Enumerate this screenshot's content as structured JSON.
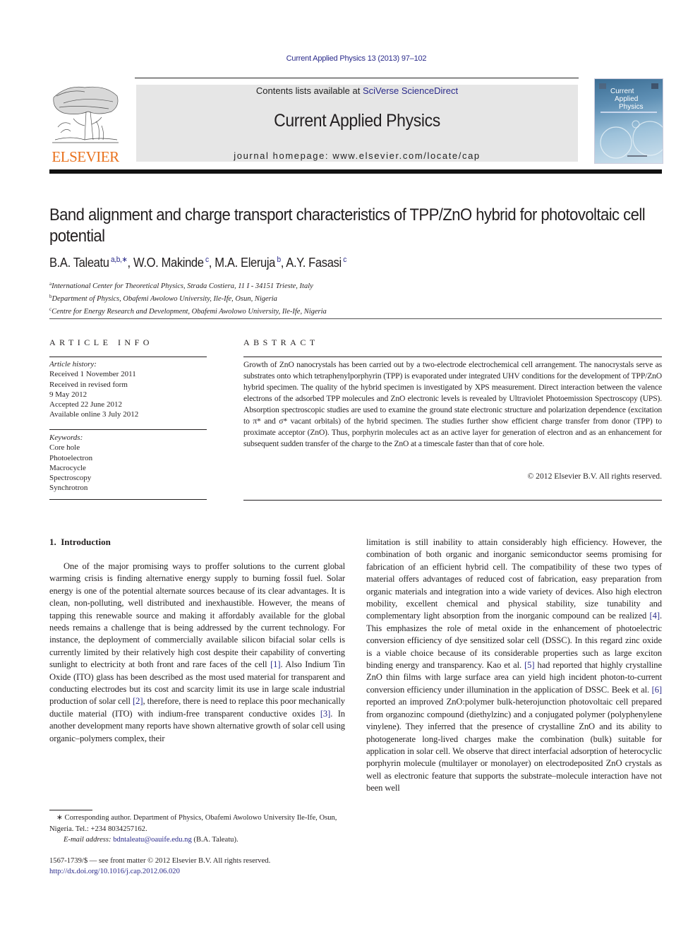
{
  "header": {
    "journal_ref": "Current Applied Physics 13 (2013) 97–102",
    "contents_prefix": "Contents lists available at ",
    "contents_link": "SciVerse ScienceDirect",
    "journal_name": "Current Applied Physics",
    "homepage": "journal homepage: www.elsevier.com/locate/cap",
    "publisher_logo_text": "ELSEVIER",
    "cover": {
      "line1": "Current",
      "line2": "Applied",
      "line3": "Physics"
    }
  },
  "article": {
    "title": "Band alignment and charge transport characteristics of TPP/ZnO hybrid for photovoltaic cell potential",
    "authors": [
      {
        "name": "B.A. Taleatu",
        "sup": "a,b,∗"
      },
      {
        "name": "W.O. Makinde",
        "sup": "c"
      },
      {
        "name": "M.A. Eleruja",
        "sup": "b"
      },
      {
        "name": "A.Y. Fasasi",
        "sup": "c"
      }
    ],
    "affiliations": [
      {
        "mark": "a",
        "text": "International Center for Theoretical Physics, Strada Costiera, 11 I - 34151 Trieste, Italy"
      },
      {
        "mark": "b",
        "text": "Department of Physics, Obafemi Awolowo University, Ile-Ife, Osun, Nigeria"
      },
      {
        "mark": "c",
        "text": "Centre for Energy Research and Development, Obafemi Awolowo University, Ile-Ife, Nigeria"
      }
    ]
  },
  "article_info": {
    "heading": "ARTICLE INFO",
    "history_label": "Article history:",
    "history": [
      "Received 1 November 2011",
      "Received in revised form",
      "9 May 2012",
      "Accepted 22 June 2012",
      "Available online 3 July 2012"
    ],
    "keywords_label": "Keywords:",
    "keywords": [
      "Core hole",
      "Photoelectron",
      "Macrocycle",
      "Spectroscopy",
      "Synchrotron"
    ]
  },
  "abstract": {
    "heading": "ABSTRACT",
    "text": "Growth of ZnO nanocrystals has been carried out by a two-electrode electrochemical cell arrangement. The nanocrystals serve as substrates onto which tetraphenylporphyrin (TPP) is evaporated under integrated UHV conditions for the development of TPP/ZnO hybrid specimen. The quality of the hybrid specimen is investigated by XPS measurement. Direct interaction between the valence electrons of the adsorbed TPP molecules and ZnO electronic levels is revealed by Ultraviolet Photoemission Spectroscopy (UPS). Absorption spectroscopic studies are used to examine the ground state electronic structure and polarization dependence (excitation to π* and σ* vacant orbitals) of the hybrid specimen. The studies further show efficient charge transfer from donor (TPP) to proximate acceptor (ZnO). Thus, porphyrin molecules act as an active layer for generation of electron and as an enhancement for subsequent sudden transfer of the charge to the ZnO at a timescale faster than that of core hole.",
    "copyright": "© 2012 Elsevier B.V. All rights reserved."
  },
  "body": {
    "section_heading": "1.  Introduction",
    "left_column": [
      {
        "t": "One of the major promising ways to proffer solutions to the current global warming crisis is finding alternative energy supply to burning fossil fuel. Solar energy is one of the potential alternate sources because of its clear advantages. It is clean, non-polluting, well distributed and inexhaustible. However, the means of tapping this renewable source and making it affordably available for the global needs remains a challenge that is being addressed by the current technology. For instance, the deployment of commercially available silicon bifacial solar cells is currently limited by their relatively high cost despite their capability of converting sunlight to electricity at both front and rare faces of the cell "
      },
      {
        "ref": "[1]"
      },
      {
        "t": ". Also Indium Tin Oxide (ITO) glass has been described as the most used material for transparent and conducting electrodes but its cost and scarcity limit its use in large scale industrial production of solar cell "
      },
      {
        "ref": "[2]"
      },
      {
        "t": ", therefore, there is need to replace this poor mechanically ductile material (ITO) with indium-free transparent conductive oxides "
      },
      {
        "ref": "[3]"
      },
      {
        "t": ". In another development many reports have shown alternative growth of solar cell using organic–polymers complex, their"
      }
    ],
    "right_column": [
      {
        "t": "limitation is still inability to attain considerably high efficiency. However, the combination of both organic and inorganic semiconductor seems promising for fabrication of an efficient hybrid cell. The compatibility of these two types of material offers advantages of reduced cost of fabrication, easy preparation from organic materials and integration into a wide variety of devices. Also high electron mobility, excellent chemical and physical stability, size tunability and complementary light absorption from the inorganic compound can be realized "
      },
      {
        "ref": "[4]"
      },
      {
        "t": ". This emphasizes the role of metal oxide in the enhancement of photoelectric conversion efficiency of dye sensitized solar cell (DSSC). In this regard zinc oxide is a viable choice because of its considerable properties such as large exciton binding energy and transparency. Kao et al. "
      },
      {
        "ref": "[5]"
      },
      {
        "t": " had reported that highly crystalline ZnO thin films with large surface area can yield high incident photon-to-current conversion efficiency under illumination in the application of DSSC. Beek et al. "
      },
      {
        "ref": "[6]"
      },
      {
        "t": " reported an improved ZnO:polymer bulk-heterojunction photovoltaic cell prepared from organozinc compound (diethylzinc) and a conjugated polymer (polyphenylene vinylene). They inferred that the presence of crystalline ZnO and its ability to photogenerate long-lived charges make the combination (bulk) suitable for application in solar cell. We observe that direct interfacial adsorption of heterocyclic porphyrin molecule (multilayer or monolayer) on electrodeposited ZnO crystals as well as electronic feature that supports the substrate–molecule interaction have not been well"
      }
    ]
  },
  "footnote": {
    "marker": "∗",
    "corresponding": " Corresponding author. Department of Physics, Obafemi Awolowo University Ile-Ife, Osun, Nigeria. Tel.: +234 8034257162.",
    "email_label": "E-mail address:",
    "email": "bdntaleatu@oauife.edu.ng",
    "email_suffix": " (B.A. Taleatu)."
  },
  "issn_line": "1567-1739/$ — see front matter © 2012 Elsevier B.V. All rights reserved.",
  "doi": "http://dx.doi.org/10.1016/j.cap.2012.06.020",
  "colors": {
    "link": "#2a2a8a",
    "elsevier_orange": "#e9711c",
    "masthead_bg": "#e6e6e6"
  }
}
